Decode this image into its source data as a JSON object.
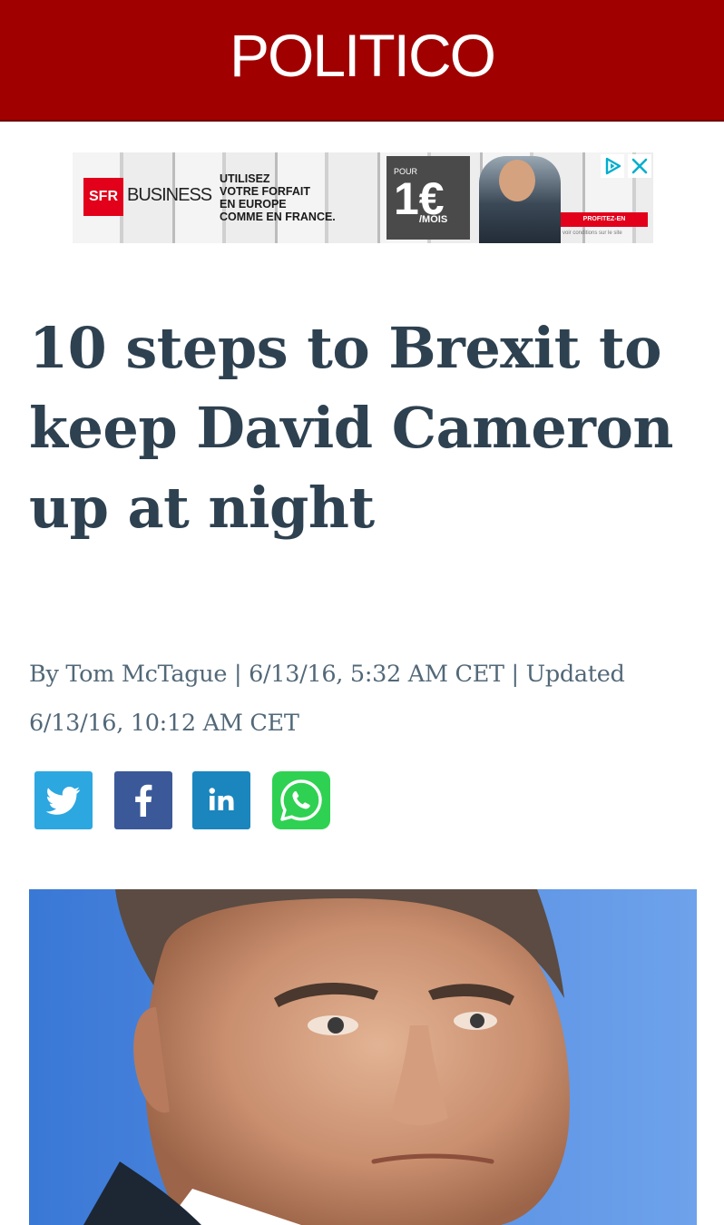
{
  "header": {
    "logo_text": "POLITICO",
    "background_color": "#a10000"
  },
  "ad": {
    "brand_box": "SFR",
    "brand_word": "BUSINESS",
    "copy_lines": [
      "UTILISEZ",
      "VOTRE FORFAIT",
      "EN EUROPE",
      "COMME EN FRANCE."
    ],
    "price_prefix": "POUR",
    "price_amount": "1€",
    "price_suffix": "/MOIS",
    "cta": "PROFITEZ-EN",
    "disclaimer": "voir conditions sur le site",
    "adchoices_icon": "adchoices-icon",
    "close_icon": "close-icon"
  },
  "article": {
    "headline": "10 steps to Brexit to keep David Cameron up at night",
    "byline": "By Tom McTague | 6/13/16, 5:32 AM CET | Updated 6/13/16, 10:12 AM CET",
    "text_color": "#2e4150"
  },
  "share": {
    "buttons": [
      {
        "network": "twitter",
        "icon": "twitter-bird-icon",
        "color": "#2ca7e0"
      },
      {
        "network": "facebook",
        "icon": "facebook-f-icon",
        "color": "#3b5998"
      },
      {
        "network": "linkedin",
        "icon": "linkedin-in-icon",
        "color": "#1b85bd"
      },
      {
        "network": "whatsapp",
        "icon": "whatsapp-phone-icon",
        "color": "#2fd152"
      }
    ]
  },
  "hero": {
    "subject": "man-portrait-photo",
    "background_color": "#5a92e4"
  }
}
